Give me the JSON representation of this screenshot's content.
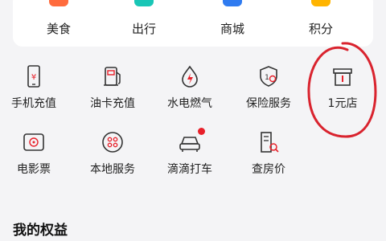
{
  "categories": [
    {
      "label": "美食",
      "icon": "food-icon",
      "color": "#ff6b3d"
    },
    {
      "label": "出行",
      "icon": "travel-icon",
      "color": "#19c6b6"
    },
    {
      "label": "商城",
      "icon": "mall-icon",
      "color": "#2f7bf0"
    },
    {
      "label": "积分",
      "icon": "points-icon",
      "color": "#ffb400"
    }
  ],
  "services": [
    {
      "label": "手机充值",
      "icon": "phone-recharge-icon"
    },
    {
      "label": "油卡充值",
      "icon": "fuel-card-icon"
    },
    {
      "label": "水电燃气",
      "icon": "utilities-icon"
    },
    {
      "label": "保险服务",
      "icon": "insurance-icon"
    },
    {
      "label": "1元店",
      "icon": "store-icon"
    },
    {
      "label": "电影票",
      "icon": "movie-ticket-icon"
    },
    {
      "label": "本地服务",
      "icon": "local-service-icon"
    },
    {
      "label": "滴滴打车",
      "icon": "taxi-icon",
      "badge": "red-dot"
    },
    {
      "label": "查房价",
      "icon": "house-price-icon"
    }
  ],
  "section": {
    "title": "我的权益"
  },
  "colors": {
    "icon_stroke": "#333333",
    "icon_accent": "#e8202a",
    "annotation": "#d9232e"
  }
}
